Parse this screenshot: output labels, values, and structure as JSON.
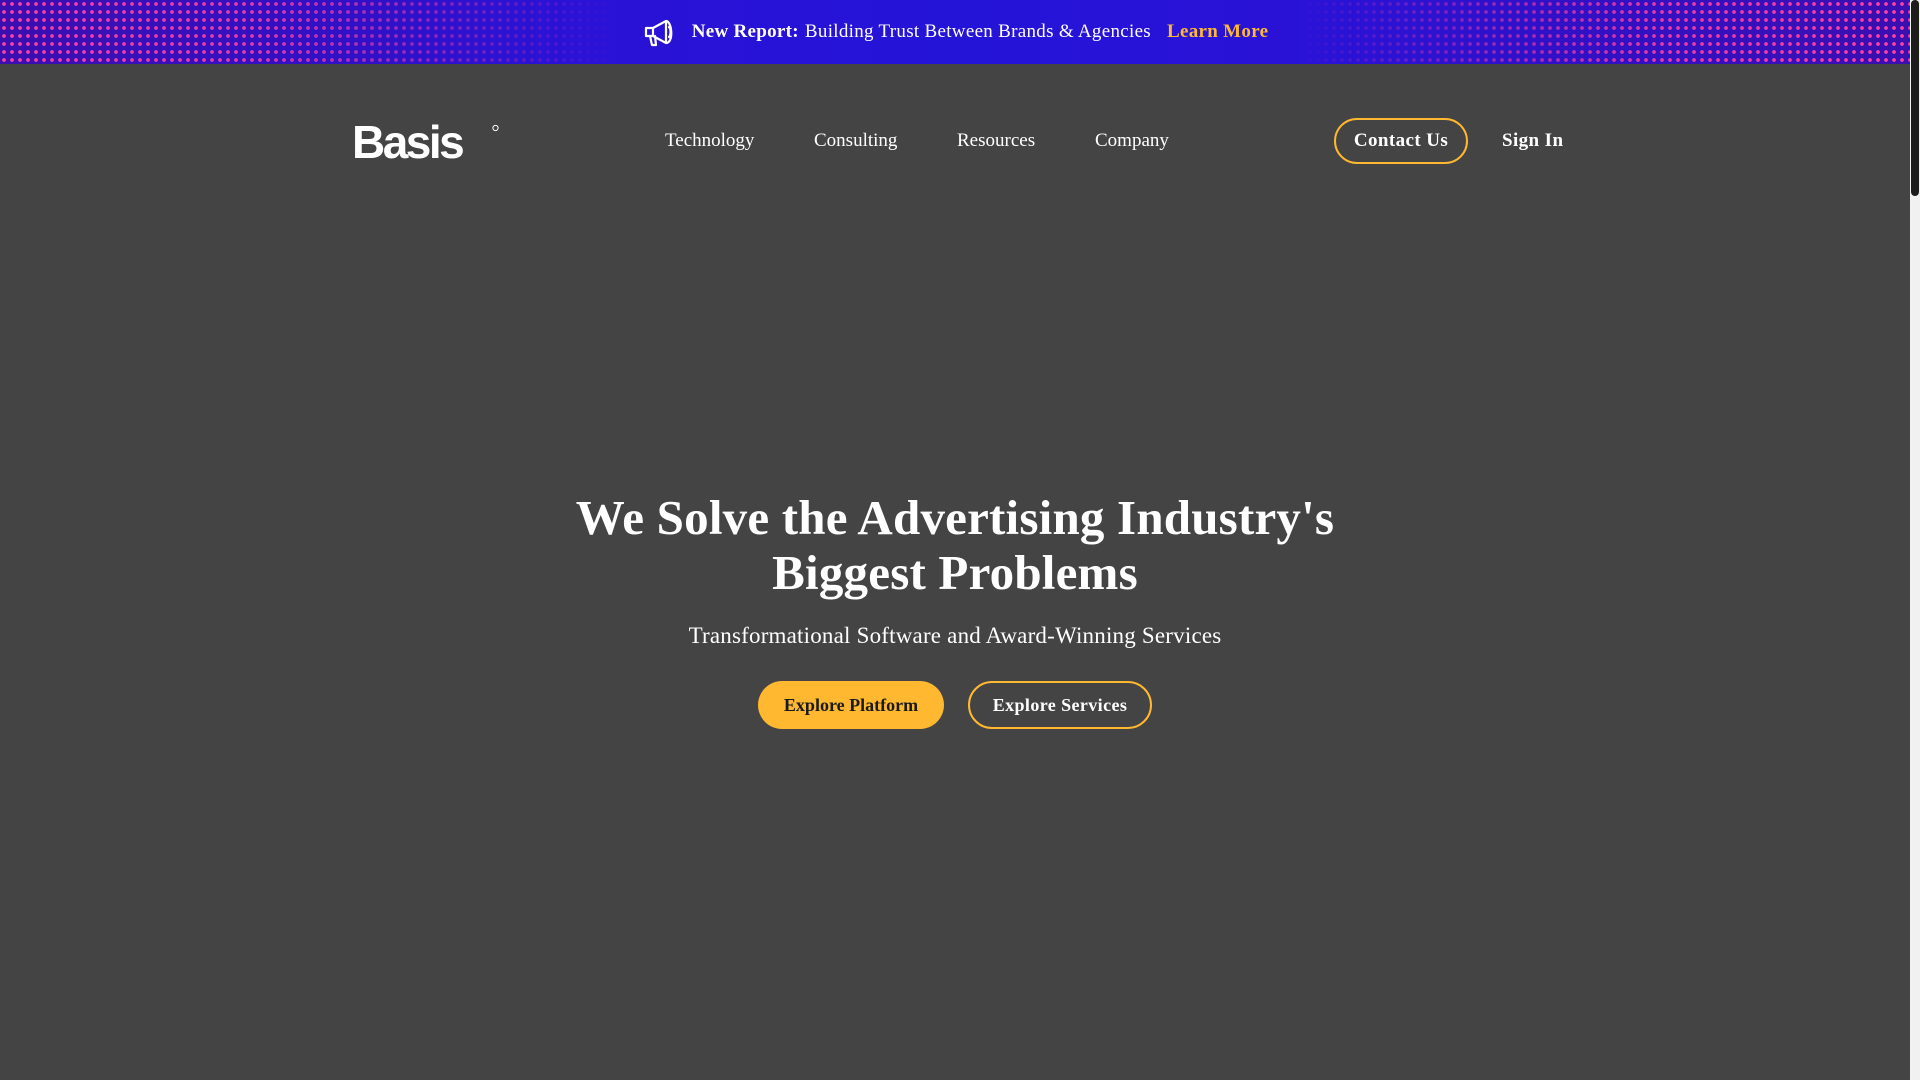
{
  "banner": {
    "icon": "megaphone-icon",
    "label": "New Report:",
    "text": "Building Trust Between Brands & Agencies",
    "link": "Learn More",
    "dot_color": "#ff3ea5",
    "background_color": "#2414d8",
    "link_color": "#ffb830"
  },
  "header": {
    "logo_text": "Basis",
    "nav": {
      "items": [
        {
          "label": "Technology"
        },
        {
          "label": "Consulting"
        },
        {
          "label": "Resources"
        },
        {
          "label": "Company"
        }
      ]
    },
    "contact_label": "Contact Us",
    "signin_label": "Sign In"
  },
  "hero": {
    "title": "We Solve the Advertising Industry's Biggest Problems",
    "subtitle": "Transformational Software and Award-Winning Services",
    "primary_button": "Explore Platform",
    "secondary_button": "Explore Services"
  },
  "colors": {
    "page_background": "#444444",
    "accent": "#ffb830",
    "text": "#ffffff"
  }
}
